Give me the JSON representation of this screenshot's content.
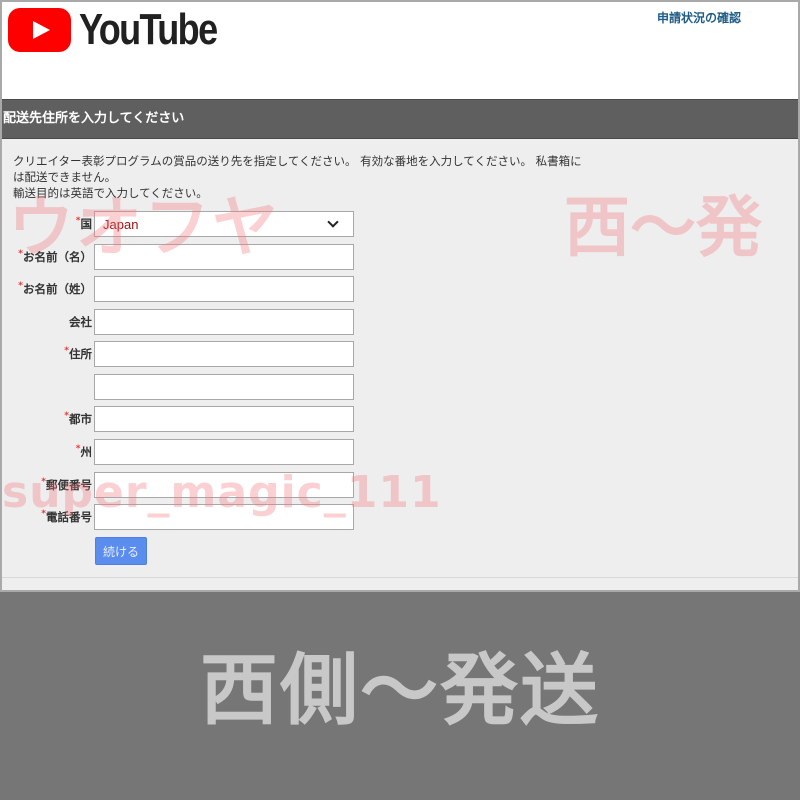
{
  "header": {
    "brand": "YouTube",
    "status_link": "申請状況の確認"
  },
  "section": {
    "title": "配送先住所を入力してください"
  },
  "intro": {
    "line1": "クリエイター表彰プログラムの賞品の送り先を指定してください。 有効な番地を入力してください。 私書箱に",
    "line2": "は配送できません。",
    "line3": "輸送目的は英語で入力してください。"
  },
  "form": {
    "required_mark": "*",
    "country": {
      "label": "国",
      "value": "Japan",
      "required": true
    },
    "first_name": {
      "label": "お名前（名）",
      "value": "",
      "required": true
    },
    "last_name": {
      "label": "お名前（姓）",
      "value": "",
      "required": true
    },
    "company": {
      "label": "会社",
      "value": "",
      "required": false
    },
    "address1": {
      "label": "住所",
      "value": "",
      "required": true
    },
    "address2": {
      "label": "",
      "value": "",
      "required": false
    },
    "city": {
      "label": "都市",
      "value": "",
      "required": true
    },
    "state": {
      "label": "州",
      "value": "",
      "required": true
    },
    "postal_code": {
      "label": "郵便番号",
      "value": "",
      "required": true
    },
    "phone": {
      "label": "電話番号",
      "value": "",
      "required": true
    },
    "continue_label": "続ける"
  },
  "watermarks": {
    "left": "ウオフヤ",
    "right": "西〜発",
    "user": "super_magic_111"
  },
  "banner": {
    "text": "西側〜発送"
  },
  "colors": {
    "brand_red": "#ff0000",
    "section_bar": "#5f5f5f",
    "link": "#1f5d87",
    "button": "#5b8def",
    "required": "#e53935"
  }
}
